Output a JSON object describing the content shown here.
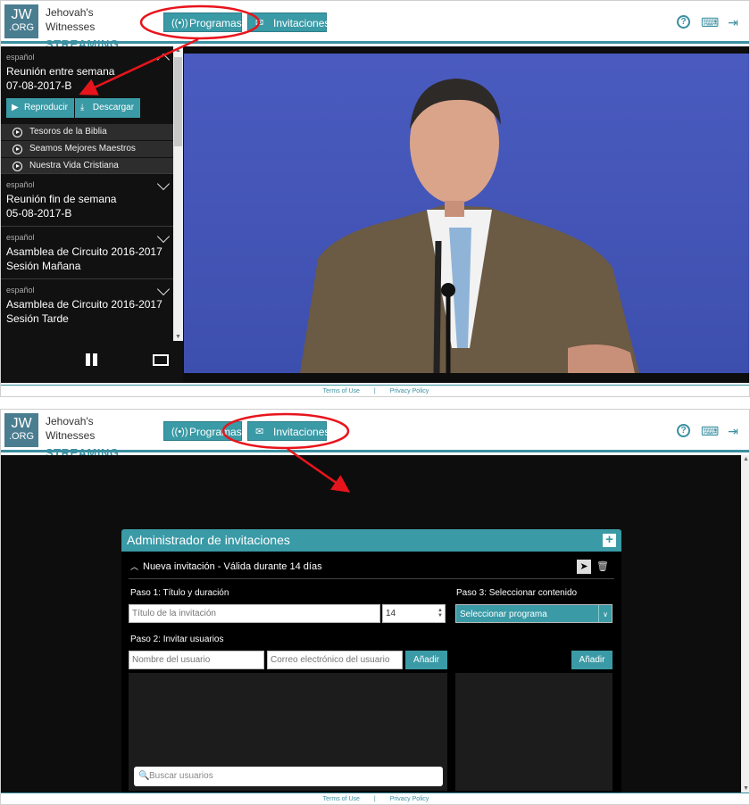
{
  "header": {
    "logo_line1": "JW",
    "logo_line2": ".ORG",
    "brand_top": "Jehovah's Witnesses",
    "brand_bottom": "STREAMING",
    "nav_programs": "Programas",
    "nav_invitations": "Invitaciones",
    "icons": [
      "help-icon",
      "language-icon",
      "logout-icon"
    ]
  },
  "footer": {
    "terms": "Terms of Use",
    "sep": "|",
    "privacy": "Privacy Policy"
  },
  "sidebar": {
    "items": [
      {
        "lang": "español",
        "title1": "Reunión entre semana",
        "title2": "07-08-2017-B",
        "expanded": true
      },
      {
        "lang": "español",
        "title1": "Reunión fin de semana",
        "title2": "05-08-2017-B",
        "expanded": false
      },
      {
        "lang": "español",
        "title1": "Asamblea de Circuito 2016-2017",
        "title2": "Sesión Mañana",
        "expanded": false
      },
      {
        "lang": "español",
        "title1": "Asamblea de Circuito 2016-2017",
        "title2": "Sesión Tarde",
        "expanded": false
      }
    ],
    "play_label": "Reproducir",
    "download_label": "Descargar",
    "chapters": [
      "Tesoros de la Biblia",
      "Seamos Mejores Maestros",
      "Nuestra Vida Cristiana"
    ]
  },
  "invites": {
    "title": "Administrador de invitaciones",
    "new_invite": "Nueva invitación - Válida durante 14 días",
    "step1": "Paso 1: Título y duración",
    "title_placeholder": "Título de la invitación",
    "duration_value": "14",
    "step2": "Paso 2: Invitar usuarios",
    "user_placeholder": "Nombre del usuario",
    "email_placeholder": "Correo electrónico del usuario",
    "add_label": "Añadir",
    "search_placeholder": "Buscar usuarios",
    "step3": "Paso 3: Seleccionar contenido",
    "select_program": "Seleccionar programa",
    "add_label2": "Añadir"
  },
  "colors": {
    "accent": "#3a9aa6",
    "annotation": "#e8141c"
  }
}
